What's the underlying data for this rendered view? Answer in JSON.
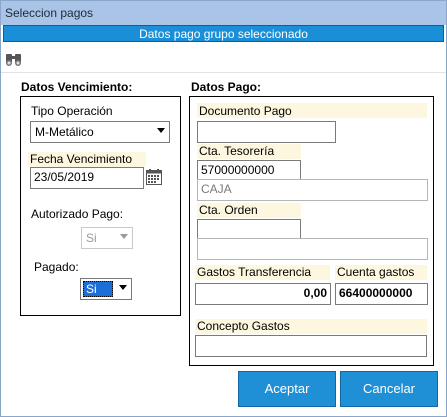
{
  "window": {
    "title": "Seleccion pagos"
  },
  "header": {
    "title": "Datos pago grupo seleccionado"
  },
  "toolbar": {
    "icon": "binoculars-icon"
  },
  "vencimiento": {
    "title": "Datos Vencimiento:",
    "tipo_operacion_label": "Tipo Operación",
    "tipo_operacion_value": "M-Metálico",
    "fecha_label": "Fecha Vencimiento",
    "fecha_value": "23/05/2019",
    "autorizado_label": "Autorizado Pago:",
    "autorizado_value": "Si",
    "pagado_label": "Pagado:",
    "pagado_value": "Si"
  },
  "pago": {
    "title": "Datos Pago:",
    "documento_label": "Documento Pago",
    "documento_value": "",
    "tesoreria_label": "Cta. Tesorería",
    "tesoreria_value": "57000000000",
    "tesoreria_desc": "CAJA",
    "orden_label": "Cta. Orden",
    "orden_value": "",
    "orden_desc": "",
    "gastos_label": "Gastos Transferencia",
    "gastos_value": "0,00",
    "cuenta_gastos_label": "Cuenta gastos",
    "cuenta_gastos_value": "66400000000",
    "concepto_label": "Concepto Gastos",
    "concepto_value": ""
  },
  "buttons": {
    "accept": "Aceptar",
    "cancel": "Cancelar"
  }
}
